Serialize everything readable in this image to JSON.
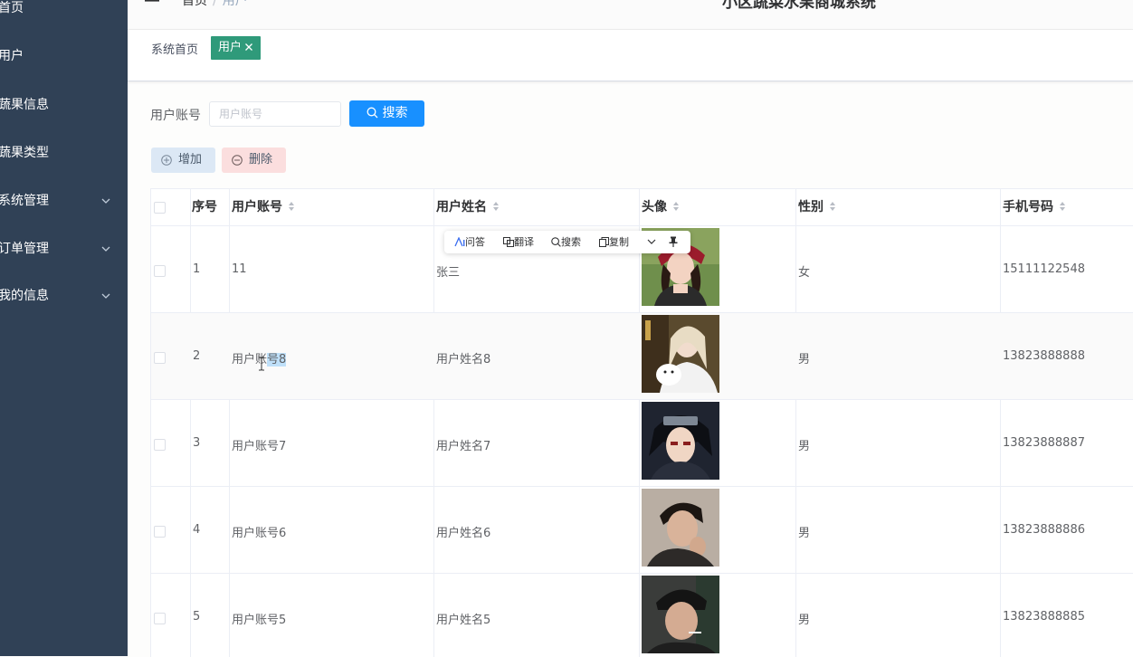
{
  "sidebar": {
    "items": [
      {
        "label": "首页",
        "has_submenu": false
      },
      {
        "label": "用户",
        "has_submenu": false
      },
      {
        "label": "蔬果信息",
        "has_submenu": false
      },
      {
        "label": "蔬果类型",
        "has_submenu": false
      },
      {
        "label": "系统管理",
        "has_submenu": true
      },
      {
        "label": "订单管理",
        "has_submenu": true
      },
      {
        "label": "我的信息",
        "has_submenu": true
      }
    ]
  },
  "header": {
    "breadcrumb": [
      "首页",
      "用户"
    ],
    "system_title": "小区蔬菜水果商城系统"
  },
  "tags": {
    "home": "系统首页",
    "active": "用户",
    "active_color": "#2f9a7a"
  },
  "search": {
    "label": "用户账号",
    "placeholder": "用户账号",
    "value": "",
    "button_label": "搜索",
    "button_color": "#1890ff"
  },
  "actions": {
    "add_label": "增加",
    "delete_label": "删除"
  },
  "table": {
    "columns": [
      "序号",
      "用户账号",
      "用户姓名",
      "头像",
      "性别",
      "手机号码"
    ],
    "rows": [
      {
        "index": "1",
        "account": "11",
        "name": "张三",
        "gender": "女",
        "phone": "15111122548",
        "avatar": "avatar-woman-red-hat"
      },
      {
        "index": "2",
        "account_prefix": "用户账",
        "account_highlight": "号8",
        "account": "用户账号8",
        "name": "用户姓名8",
        "gender": "男",
        "phone": "13823888888",
        "avatar": "avatar-woman-white-cat"
      },
      {
        "index": "3",
        "account": "用户账号7",
        "name": "用户姓名7",
        "gender": "男",
        "phone": "13823888887",
        "avatar": "avatar-anime-ninja"
      },
      {
        "index": "4",
        "account": "用户账号6",
        "name": "用户姓名6",
        "gender": "男",
        "phone": "13823888886",
        "avatar": "avatar-man-selfie"
      },
      {
        "index": "5",
        "account": "用户账号5",
        "name": "用户姓名5",
        "gender": "男",
        "phone": "13823888885",
        "avatar": "avatar-man-cap"
      }
    ]
  },
  "selection_toolbar": {
    "items": [
      "问答",
      "翻译",
      "搜索",
      "复制"
    ]
  }
}
